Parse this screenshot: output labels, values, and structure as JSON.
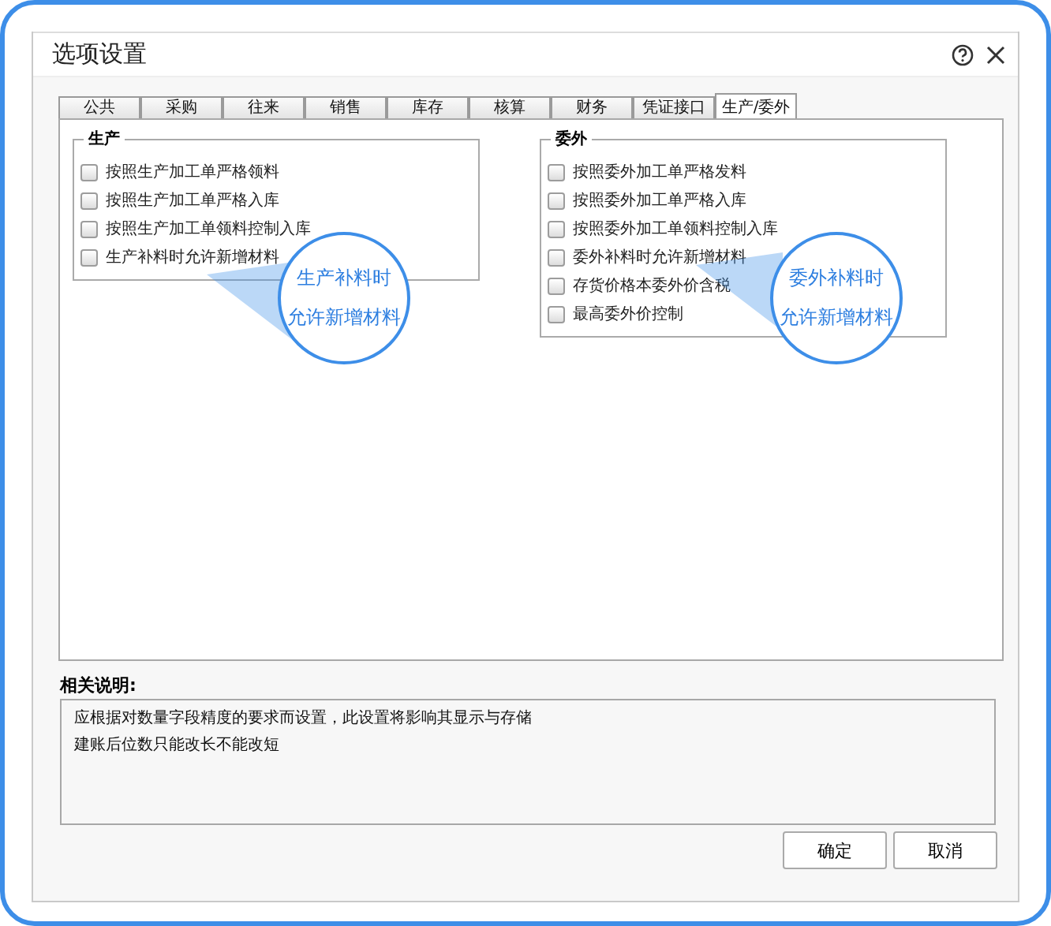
{
  "window": {
    "title": "选项设置",
    "buttons": [
      {
        "kind": "help"
      },
      {
        "kind": "close"
      }
    ]
  },
  "tabs": [
    {
      "label": "公共",
      "selected": false
    },
    {
      "label": "采购",
      "selected": false
    },
    {
      "label": "往来",
      "selected": false
    },
    {
      "label": "销售",
      "selected": false
    },
    {
      "label": "库存",
      "selected": false
    },
    {
      "label": "核算",
      "selected": false
    },
    {
      "label": "财务",
      "selected": false
    },
    {
      "label": "凭证接口",
      "selected": false
    },
    {
      "label": "生产/委外",
      "selected": true
    }
  ],
  "groups": [
    {
      "title": "生产",
      "options": [
        {
          "label": "按照生产加工单严格领料",
          "checked": false
        },
        {
          "label": "按照生产加工单严格入库",
          "checked": false
        },
        {
          "label": "按照生产加工单领料控制入库",
          "checked": false
        },
        {
          "label": "生产补料时允许新增材料",
          "checked": false
        }
      ],
      "callout": {
        "lines": [
          "生产补料时",
          "允许新增材料"
        ]
      }
    },
    {
      "title": "委外",
      "options": [
        {
          "label": "按照委外加工单严格发料",
          "checked": false
        },
        {
          "label": "按照委外加工单严格入库",
          "checked": false
        },
        {
          "label": "按照委外加工单领料控制入库",
          "checked": false
        },
        {
          "label": "委外补料时允许新增材料",
          "checked": false
        },
        {
          "label": "存货价格本委外价含税",
          "checked": false
        },
        {
          "label": "最高委外价控制",
          "checked": false
        }
      ],
      "callout": {
        "lines": [
          "委外补料时",
          "允许新增材料"
        ]
      }
    }
  ],
  "description": {
    "label": "相关说明:",
    "lines": [
      "应根据对数量字段精度的要求而设置，此设置将影响其显示与存储",
      "建账后位数只能改长不能改短"
    ]
  },
  "buttons": [
    "确定",
    "取消"
  ]
}
